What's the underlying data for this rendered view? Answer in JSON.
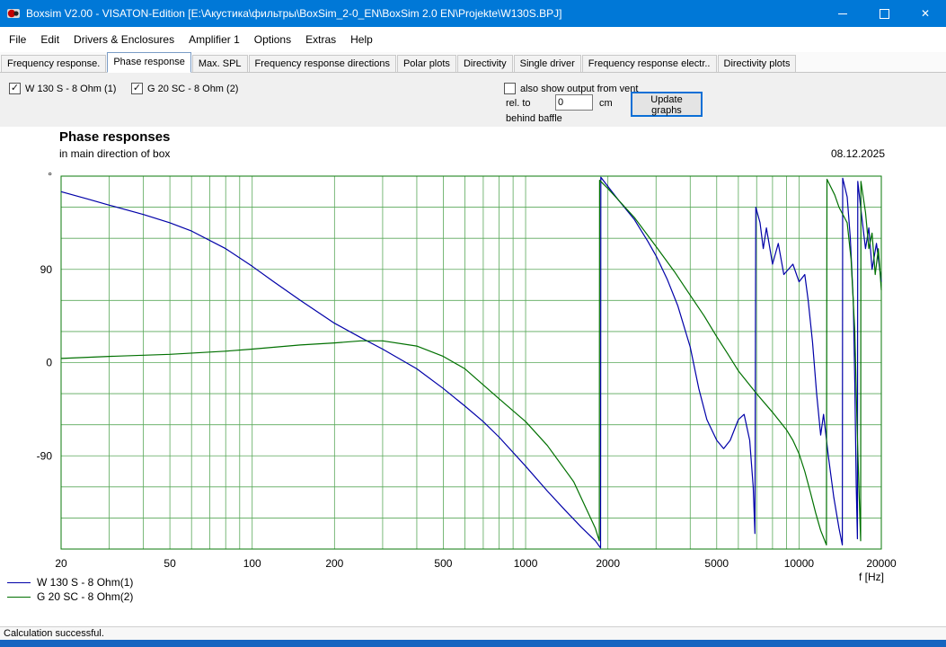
{
  "window": {
    "title": "Boxsim V2.00 - VISATON-Edition [E:\\Акустика\\фильтры\\BoxSim_2-0_EN\\BoxSim 2.0 EN\\Projekte\\W130S.BPJ]",
    "buttons": {
      "close_glyph": "✕"
    }
  },
  "menu": {
    "items": [
      "File",
      "Edit",
      "Drivers & Enclosures",
      "Amplifier 1",
      "Options",
      "Extras",
      "Help"
    ]
  },
  "tabs": {
    "active_index": 1,
    "items": [
      "Frequency response.",
      "Phase response",
      "Max. SPL",
      "Frequency response directions",
      "Polar plots",
      "Directivity",
      "Single driver",
      "Frequency response electr..",
      "Directivity plots"
    ]
  },
  "controls": {
    "driver1": {
      "label": "W 130 S - 8 Ohm (1)",
      "checked": true
    },
    "driver2": {
      "label": "G 20 SC - 8 Ohm (2)",
      "checked": true
    },
    "vent": {
      "label": "also show output from vent",
      "checked": false
    },
    "rel_to_label": "rel. to",
    "rel_to_value": "0",
    "unit_label": "cm",
    "behind_baffle_label": "behind baffle",
    "update_button": "Update graphs"
  },
  "chart_data": {
    "type": "line",
    "title": "Phase responses",
    "subtitle": "in main direction of box",
    "date": "08.12.2025",
    "xlabel": "f [Hz]",
    "x_scale": "log",
    "x_min": 20,
    "x_max": 20000,
    "y_min": -180,
    "y_max": 180,
    "y_unit": "degrees",
    "y_grid_step": 30,
    "grid_on": true,
    "grid_color": "#5aa85a",
    "axis_color": "#0a7a0a",
    "x_ticks": [
      20,
      50,
      100,
      200,
      500,
      1000,
      2000,
      5000,
      10000,
      20000
    ],
    "y_ticks": [
      {
        "value": 180,
        "label": "°"
      },
      {
        "value": 90,
        "label": "90"
      },
      {
        "value": 0,
        "label": "0"
      },
      {
        "value": -90,
        "label": "-90"
      }
    ],
    "legend_position": "bottom-left",
    "series": [
      {
        "name": "W 130 S - 8 Ohm(1)",
        "color": "#0000a8",
        "points": [
          [
            20,
            165
          ],
          [
            25,
            158
          ],
          [
            30,
            152
          ],
          [
            40,
            143
          ],
          [
            50,
            135
          ],
          [
            60,
            127
          ],
          [
            80,
            110
          ],
          [
            100,
            93
          ],
          [
            120,
            78
          ],
          [
            150,
            60
          ],
          [
            200,
            38
          ],
          [
            250,
            24
          ],
          [
            300,
            13
          ],
          [
            400,
            -6
          ],
          [
            500,
            -25
          ],
          [
            600,
            -42
          ],
          [
            700,
            -57
          ],
          [
            800,
            -72
          ],
          [
            1000,
            -100
          ],
          [
            1200,
            -124
          ],
          [
            1400,
            -143
          ],
          [
            1600,
            -159
          ],
          [
            1800,
            -172
          ],
          [
            1880,
            -179
          ],
          [
            1885,
            179
          ],
          [
            2000,
            170
          ],
          [
            2200,
            156
          ],
          [
            2500,
            138
          ],
          [
            2800,
            117
          ],
          [
            3000,
            103
          ],
          [
            3300,
            80
          ],
          [
            3600,
            55
          ],
          [
            4000,
            15
          ],
          [
            4300,
            -25
          ],
          [
            4600,
            -55
          ],
          [
            5000,
            -75
          ],
          [
            5300,
            -83
          ],
          [
            5600,
            -75
          ],
          [
            6000,
            -55
          ],
          [
            6300,
            -50
          ],
          [
            6600,
            -75
          ],
          [
            6800,
            -120
          ],
          [
            6900,
            -165
          ],
          [
            6950,
            150
          ],
          [
            7200,
            135
          ],
          [
            7400,
            110
          ],
          [
            7600,
            130
          ],
          [
            8000,
            95
          ],
          [
            8400,
            115
          ],
          [
            8800,
            85
          ],
          [
            9500,
            95
          ],
          [
            10000,
            78
          ],
          [
            10500,
            85
          ],
          [
            10800,
            60
          ],
          [
            11200,
            20
          ],
          [
            11600,
            -30
          ],
          [
            12000,
            -70
          ],
          [
            12300,
            -50
          ],
          [
            12800,
            -90
          ],
          [
            13400,
            -130
          ],
          [
            14000,
            -160
          ],
          [
            14400,
            -176
          ],
          [
            14450,
            178
          ],
          [
            15000,
            160
          ],
          [
            15400,
            120
          ],
          [
            15800,
            60
          ],
          [
            16000,
            -20
          ],
          [
            16200,
            -120
          ],
          [
            16350,
            -170
          ],
          [
            16400,
            175
          ],
          [
            16800,
            150
          ],
          [
            17500,
            110
          ],
          [
            18000,
            130
          ],
          [
            18500,
            90
          ],
          [
            19200,
            115
          ],
          [
            20000,
            78
          ]
        ]
      },
      {
        "name": "G 20 SC - 8 Ohm(2)",
        "color": "#007000",
        "points": [
          [
            20,
            4
          ],
          [
            30,
            6
          ],
          [
            50,
            8
          ],
          [
            80,
            11
          ],
          [
            100,
            13
          ],
          [
            150,
            17
          ],
          [
            200,
            19
          ],
          [
            250,
            21
          ],
          [
            300,
            21
          ],
          [
            400,
            16
          ],
          [
            500,
            6
          ],
          [
            600,
            -6
          ],
          [
            800,
            -35
          ],
          [
            1000,
            -57
          ],
          [
            1200,
            -80
          ],
          [
            1500,
            -115
          ],
          [
            1800,
            -160
          ],
          [
            1860,
            -172
          ],
          [
            1865,
            176
          ],
          [
            2000,
            168
          ],
          [
            2500,
            140
          ],
          [
            3000,
            112
          ],
          [
            3500,
            88
          ],
          [
            4000,
            65
          ],
          [
            4500,
            45
          ],
          [
            5000,
            25
          ],
          [
            5500,
            8
          ],
          [
            6000,
            -8
          ],
          [
            7000,
            -30
          ],
          [
            8000,
            -48
          ],
          [
            9000,
            -65
          ],
          [
            9500,
            -75
          ],
          [
            10000,
            -88
          ],
          [
            10500,
            -105
          ],
          [
            11000,
            -125
          ],
          [
            11500,
            -145
          ],
          [
            12000,
            -162
          ],
          [
            12600,
            -176
          ],
          [
            12650,
            177
          ],
          [
            13500,
            162
          ],
          [
            14000,
            150
          ],
          [
            15000,
            135
          ],
          [
            15500,
            100
          ],
          [
            16000,
            30
          ],
          [
            16300,
            -60
          ],
          [
            16600,
            -130
          ],
          [
            16800,
            -172
          ],
          [
            16850,
            175
          ],
          [
            17500,
            145
          ],
          [
            18000,
            110
          ],
          [
            18500,
            125
          ],
          [
            19000,
            85
          ],
          [
            19500,
            110
          ],
          [
            20000,
            70
          ]
        ]
      }
    ]
  },
  "status": {
    "text": "Calculation successful."
  }
}
